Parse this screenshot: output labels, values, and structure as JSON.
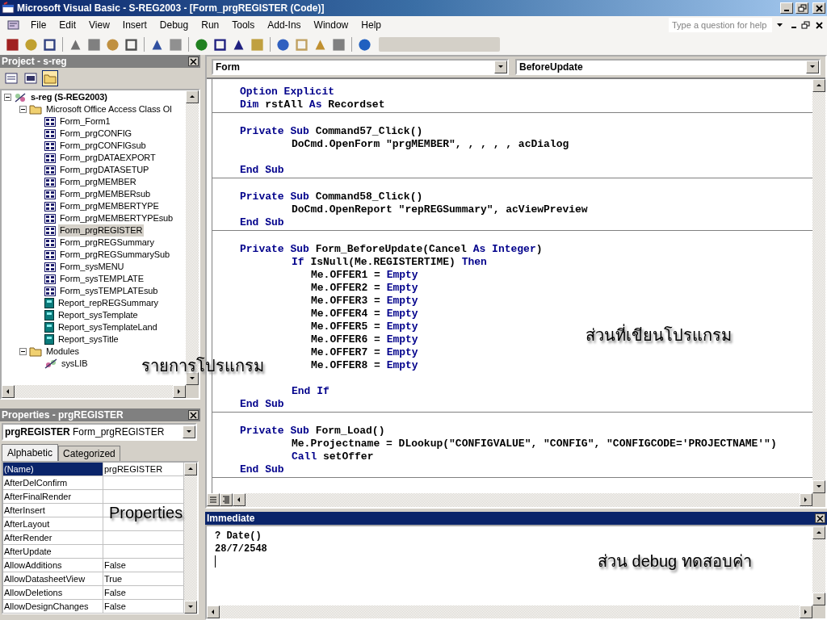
{
  "window": {
    "title": "Microsoft Visual Basic - S-REG2003 - [Form_prgREGISTER (Code)]"
  },
  "menu": [
    "File",
    "Edit",
    "View",
    "Insert",
    "Debug",
    "Run",
    "Tools",
    "Add-Ins",
    "Window",
    "Help"
  ],
  "help_box": {
    "placeholder": "Type a question for help"
  },
  "project": {
    "title": "Project - s-reg",
    "tree": [
      {
        "label": "s-reg (S-REG2003)",
        "kind": "project",
        "expanded": true,
        "selected": false,
        "children": [
          {
            "label": "Microsoft Office Access Class Ol",
            "kind": "folder",
            "expanded": true,
            "selected": false,
            "children": [
              {
                "label": "Form_Form1",
                "kind": "form",
                "selected": false
              },
              {
                "label": "Form_prgCONFIG",
                "kind": "form",
                "selected": false
              },
              {
                "label": "Form_prgCONFIGsub",
                "kind": "form",
                "selected": false
              },
              {
                "label": "Form_prgDATAEXPORT",
                "kind": "form",
                "selected": false
              },
              {
                "label": "Form_prgDATASETUP",
                "kind": "form",
                "selected": false
              },
              {
                "label": "Form_prgMEMBER",
                "kind": "form",
                "selected": false
              },
              {
                "label": "Form_prgMEMBERsub",
                "kind": "form",
                "selected": false
              },
              {
                "label": "Form_prgMEMBERTYPE",
                "kind": "form",
                "selected": false
              },
              {
                "label": "Form_prgMEMBERTYPEsub",
                "kind": "form",
                "selected": false
              },
              {
                "label": "Form_prgREGISTER",
                "kind": "form",
                "selected": true
              },
              {
                "label": "Form_prgREGSummary",
                "kind": "form",
                "selected": false
              },
              {
                "label": "Form_prgREGSummarySub",
                "kind": "form",
                "selected": false
              },
              {
                "label": "Form_sysMENU",
                "kind": "form",
                "selected": false
              },
              {
                "label": "Form_sysTEMPLATE",
                "kind": "form",
                "selected": false
              },
              {
                "label": "Form_sysTEMPLATEsub",
                "kind": "form",
                "selected": false
              },
              {
                "label": "Report_repREGSummary",
                "kind": "report",
                "selected": false
              },
              {
                "label": "Report_sysTemplate",
                "kind": "report",
                "selected": false
              },
              {
                "label": "Report_sysTemplateLand",
                "kind": "report",
                "selected": false
              },
              {
                "label": "Report_sysTitle",
                "kind": "report",
                "selected": false
              }
            ]
          },
          {
            "label": "Modules",
            "kind": "folder",
            "expanded": true,
            "selected": false,
            "children": [
              {
                "label": "sysLIB",
                "kind": "module",
                "selected": false
              }
            ]
          }
        ]
      }
    ]
  },
  "properties": {
    "title": "Properties - prgREGISTER",
    "object": "**prgREGISTER** Form_prgREGISTER",
    "tabs": [
      {
        "label": "Alphabetic",
        "selected": true
      },
      {
        "label": "Categorized",
        "selected": false
      }
    ],
    "rows": [
      {
        "name": "(Name)",
        "value": "prgREGISTER",
        "selected": true
      },
      {
        "name": "AfterDelConfirm",
        "selected": false
      },
      {
        "name": "AfterFinalRender",
        "selected": false
      },
      {
        "name": "AfterInsert",
        "selected": false
      },
      {
        "name": "AfterLayout",
        "selected": false
      },
      {
        "name": "AfterRender",
        "selected": false
      },
      {
        "name": "AfterUpdate",
        "selected": false
      },
      {
        "name": "AllowAdditions",
        "value": "False",
        "selected": false
      },
      {
        "name": "AllowDatasheetView",
        "value": "True",
        "selected": false
      },
      {
        "name": "AllowDeletions",
        "value": "False",
        "selected": false
      },
      {
        "name": "AllowDesignChanges",
        "value": "False",
        "selected": false
      }
    ]
  },
  "code_window": {
    "object": "Form",
    "procedure": "BeforeUpdate",
    "sections": [
      [
        {
          "kind": "top",
          "parts": [
            {
              "kind": "keyword",
              "text": "Option Explicit"
            }
          ]
        },
        {
          "kind": "top",
          "parts": [
            {
              "kind": "keyword",
              "text": "Dim"
            },
            {
              "kind": "plain",
              "text": " rstAll "
            },
            {
              "kind": "keyword",
              "text": "As"
            },
            {
              "kind": "plain",
              "text": " Recordset"
            }
          ]
        }
      ],
      [
        {
          "kind": "top",
          "parts": [
            {
              "kind": "keyword",
              "text": "Private Sub"
            },
            {
              "kind": "plain",
              "text": " Command57_Click()"
            }
          ]
        },
        {
          "kind": "body",
          "parts": [
            {
              "kind": "plain",
              "text": "DoCmd.OpenForm \"prgMEMBER\", , , , , acDialog"
            }
          ]
        },
        {
          "kind": "blank"
        },
        {
          "kind": "top",
          "parts": [
            {
              "kind": "keyword",
              "text": "End Sub"
            }
          ]
        }
      ],
      [
        {
          "kind": "top",
          "parts": [
            {
              "kind": "keyword",
              "text": "Private Sub"
            },
            {
              "kind": "plain",
              "text": " Command58_Click()"
            }
          ]
        },
        {
          "kind": "body",
          "parts": [
            {
              "kind": "plain",
              "text": "DoCmd.OpenReport \"repREGSummary\", acViewPreview"
            }
          ]
        },
        {
          "kind": "top",
          "parts": [
            {
              "kind": "keyword",
              "text": "End Sub"
            }
          ]
        }
      ],
      [
        {
          "kind": "top",
          "parts": [
            {
              "kind": "keyword",
              "text": "Private Sub"
            },
            {
              "kind": "plain",
              "text": " Form_BeforeUpdate(Cancel "
            },
            {
              "kind": "keyword",
              "text": "As Integer"
            },
            {
              "kind": "plain",
              "text": ")"
            }
          ]
        },
        {
          "kind": "body",
          "parts": [
            {
              "kind": "keyword",
              "text": "If"
            },
            {
              "kind": "plain",
              "text": " IsNull(Me.REGISTERTIME) "
            },
            {
              "kind": "keyword",
              "text": "Then"
            }
          ]
        },
        {
          "kind": "inner",
          "parts": [
            {
              "kind": "plain",
              "text": "Me.OFFER1 = "
            },
            {
              "kind": "keyword",
              "text": "Empty"
            }
          ]
        },
        {
          "kind": "inner",
          "parts": [
            {
              "kind": "plain",
              "text": "Me.OFFER2 = "
            },
            {
              "kind": "keyword",
              "text": "Empty"
            }
          ]
        },
        {
          "kind": "inner",
          "parts": [
            {
              "kind": "plain",
              "text": "Me.OFFER3 = "
            },
            {
              "kind": "keyword",
              "text": "Empty"
            }
          ]
        },
        {
          "kind": "inner",
          "parts": [
            {
              "kind": "plain",
              "text": "Me.OFFER4 = "
            },
            {
              "kind": "keyword",
              "text": "Empty"
            }
          ]
        },
        {
          "kind": "inner",
          "parts": [
            {
              "kind": "plain",
              "text": "Me.OFFER5 = "
            },
            {
              "kind": "keyword",
              "text": "Empty"
            }
          ]
        },
        {
          "kind": "inner",
          "parts": [
            {
              "kind": "plain",
              "text": "Me.OFFER6 = "
            },
            {
              "kind": "keyword",
              "text": "Empty"
            }
          ]
        },
        {
          "kind": "inner",
          "parts": [
            {
              "kind": "plain",
              "text": "Me.OFFER7 = "
            },
            {
              "kind": "keyword",
              "text": "Empty"
            }
          ]
        },
        {
          "kind": "inner",
          "parts": [
            {
              "kind": "plain",
              "text": "Me.OFFER8 = "
            },
            {
              "kind": "keyword",
              "text": "Empty"
            }
          ]
        },
        {
          "kind": "blank"
        },
        {
          "kind": "body",
          "parts": [
            {
              "kind": "keyword",
              "text": "End If"
            }
          ]
        },
        {
          "kind": "top",
          "parts": [
            {
              "kind": "keyword",
              "text": "End Sub"
            }
          ]
        }
      ],
      [
        {
          "kind": "top",
          "parts": [
            {
              "kind": "keyword",
              "text": "Private Sub"
            },
            {
              "kind": "plain",
              "text": " Form_Load()"
            }
          ]
        },
        {
          "kind": "body",
          "parts": [
            {
              "kind": "plain",
              "text": "Me.Projectname = DLookup(\"CONFIGVALUE\", \"CONFIG\", \"CONFIGCODE='PROJECTNAME'\")"
            }
          ]
        },
        {
          "kind": "body",
          "parts": [
            {
              "kind": "keyword",
              "text": "Call"
            },
            {
              "kind": "plain",
              "text": " setOffer"
            }
          ]
        },
        {
          "kind": "top",
          "parts": [
            {
              "kind": "keyword",
              "text": "End Sub"
            }
          ]
        }
      ]
    ]
  },
  "immediate": {
    "title": "Immediate",
    "lines": [
      "? Date()",
      "28/7/2548"
    ]
  },
  "annotations": [
    "รายการโปรแกรม",
    "Properties",
    "ส่วนที่เขียนโปรแกรม",
    "ส่วน debug ทดสอบค่า"
  ]
}
